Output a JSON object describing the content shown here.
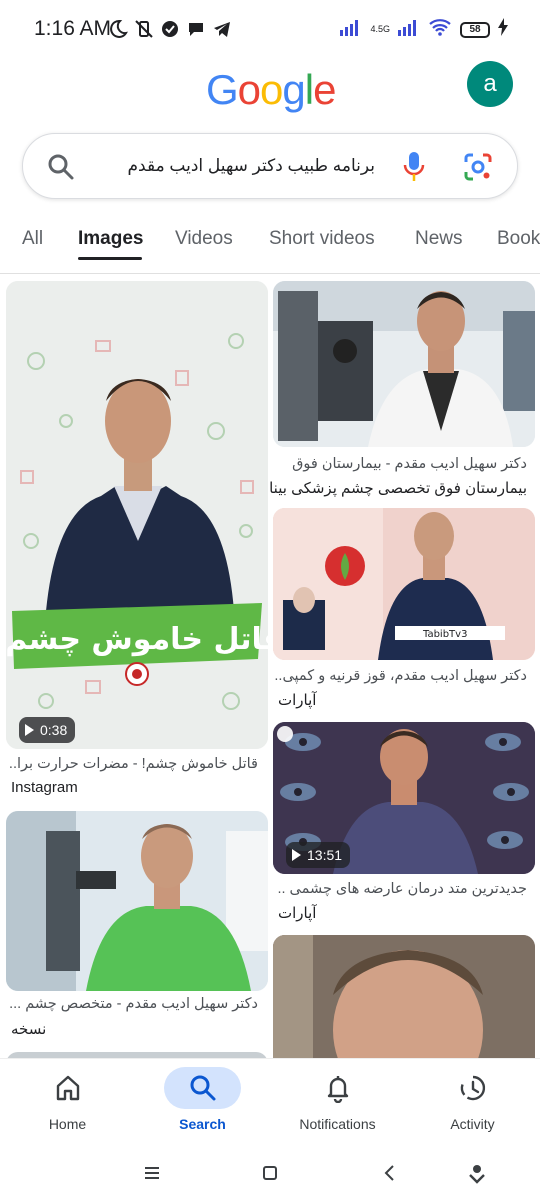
{
  "status_bar": {
    "time": "1:16 AM",
    "network": "4.5G",
    "battery": "58"
  },
  "header": {
    "logo_letters": [
      "G",
      "o",
      "o",
      "g",
      "l",
      "e"
    ],
    "avatar_letter": "a"
  },
  "search": {
    "query": "برنامه طبیب دکتر سهیل ادیب مقدم"
  },
  "tabs": [
    "All",
    "Images",
    "Videos",
    "Short videos",
    "News",
    "Books"
  ],
  "active_tab": "Images",
  "results": {
    "left": [
      {
        "caption": "قاتل خاموش چشم! - مضرات حرارت برا...",
        "source": "Instagram",
        "duration": "0:38",
        "overlay_text": "قاتل خاموش چشم!"
      },
      {
        "caption": "دکتر سهیل ادیب مقدم - متخصص چشم ...",
        "source": "نسخه"
      }
    ],
    "right": [
      {
        "caption": "دکتر سهیل ادیب مقدم - بیمارستان فوق",
        "source": "بیمارستان فوق تخصصی چشم پزشکی بینا"
      },
      {
        "caption": "دکتر سهیل ادیب مقدم، قوز قرنیه و کمپی...",
        "source": "آپارات",
        "overlay_text": "TabibTv3"
      },
      {
        "caption": "جدیدترین متد درمان عارضه های چشمی ..",
        "source": "آپارات",
        "duration": "13:51"
      }
    ]
  },
  "bottom_nav": [
    {
      "label": "Home",
      "icon": "home-icon"
    },
    {
      "label": "Search",
      "icon": "search-icon"
    },
    {
      "label": "Notifications",
      "icon": "bell-icon"
    },
    {
      "label": "Activity",
      "icon": "activity-icon"
    }
  ],
  "colors": {
    "accent": "#0b57d0",
    "avatar": "#00897B",
    "nav_active_bg": "#d3e3fd"
  }
}
